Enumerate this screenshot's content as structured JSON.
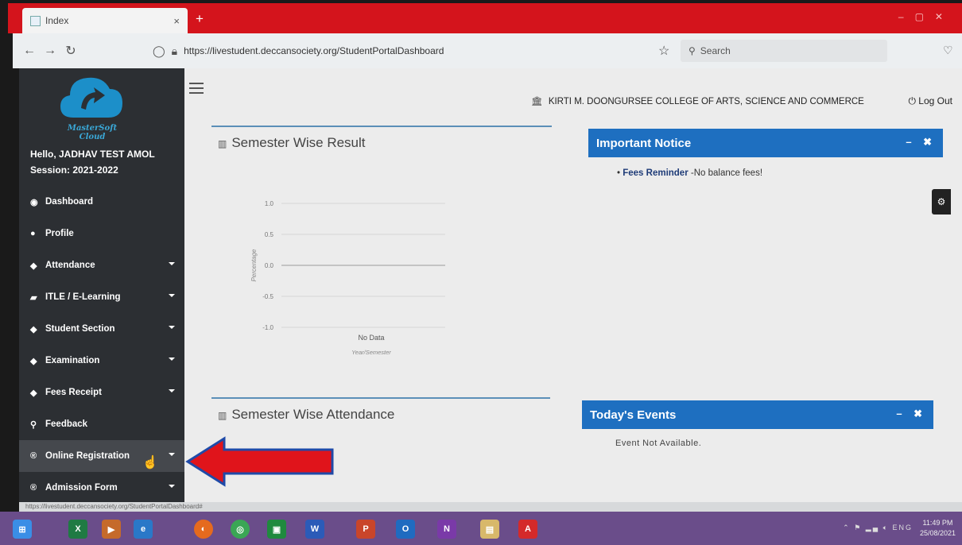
{
  "browser": {
    "tab_title": "Index",
    "tab_close": "×",
    "new_tab": "+",
    "url": "https://livestudent.deccansociety.org/StudentPortalDashboard",
    "search_placeholder": "Search"
  },
  "sidebar": {
    "brand": "MasterSoft Cloud",
    "greeting": "Hello, JADHAV TEST AMOL",
    "session": "Session: 2021-2022",
    "items": [
      {
        "label": "Dashboard",
        "icon": "dashboard-icon",
        "glyph": "◉",
        "has_caret": false
      },
      {
        "label": "Profile",
        "icon": "profile-icon",
        "glyph": "●",
        "has_caret": false
      },
      {
        "label": "Attendance",
        "icon": "diamond-icon",
        "glyph": "◆",
        "has_caret": true
      },
      {
        "label": "ITLE / E-Learning",
        "icon": "graduation-cap-icon",
        "glyph": "▰",
        "has_caret": true
      },
      {
        "label": "Student Section",
        "icon": "diamond-icon",
        "glyph": "◆",
        "has_caret": true
      },
      {
        "label": "Examination",
        "icon": "diamond-icon",
        "glyph": "◆",
        "has_caret": true
      },
      {
        "label": "Fees Receipt",
        "icon": "diamond-icon",
        "glyph": "◆",
        "has_caret": true
      },
      {
        "label": "Feedback",
        "icon": "search-icon",
        "glyph": "⚲",
        "has_caret": false
      },
      {
        "label": "Online Registration",
        "icon": "registered-icon",
        "glyph": "®",
        "has_caret": true
      },
      {
        "label": "Admission Form",
        "icon": "registered-icon",
        "glyph": "®",
        "has_caret": true
      }
    ]
  },
  "header": {
    "college": "KIRTI M. DOONGURSEE COLLEGE OF ARTS, SCIENCE AND COMMERCE",
    "logout": "Log Out"
  },
  "result_card": {
    "title": "Semester Wise Result"
  },
  "attendance_card": {
    "title": "Semester Wise Attendance"
  },
  "chart_data": {
    "type": "line",
    "title": "",
    "ylabel": "Percentage",
    "xlabel": "Year/Semester",
    "categories": [
      "No Data"
    ],
    "y_ticks": [
      "1.0",
      "0.5",
      "0.0",
      "-0.5",
      "-1.0"
    ],
    "ylim": [
      -1.0,
      1.0
    ],
    "series": []
  },
  "notice": {
    "title": "Important Notice",
    "item_bold": "Fees Reminder",
    "item_text": " -No balance fees!"
  },
  "events": {
    "title": "Today's Events",
    "empty": "Event Not Available."
  },
  "panel_controls": {
    "minimize": "–",
    "close": "✖"
  },
  "statusbar": {
    "url": "https://livestudent.deccansociety.org/StudentPortalDashboard#"
  },
  "taskbar": {
    "lang": "ENG",
    "time": "11:49 PM",
    "date": "25/08/2021"
  },
  "colors": {
    "accent": "#1e6fc0",
    "sidebar": "#2c2f33",
    "tabbar": "#d4141c",
    "annotation_arrow": "#e0141b"
  }
}
